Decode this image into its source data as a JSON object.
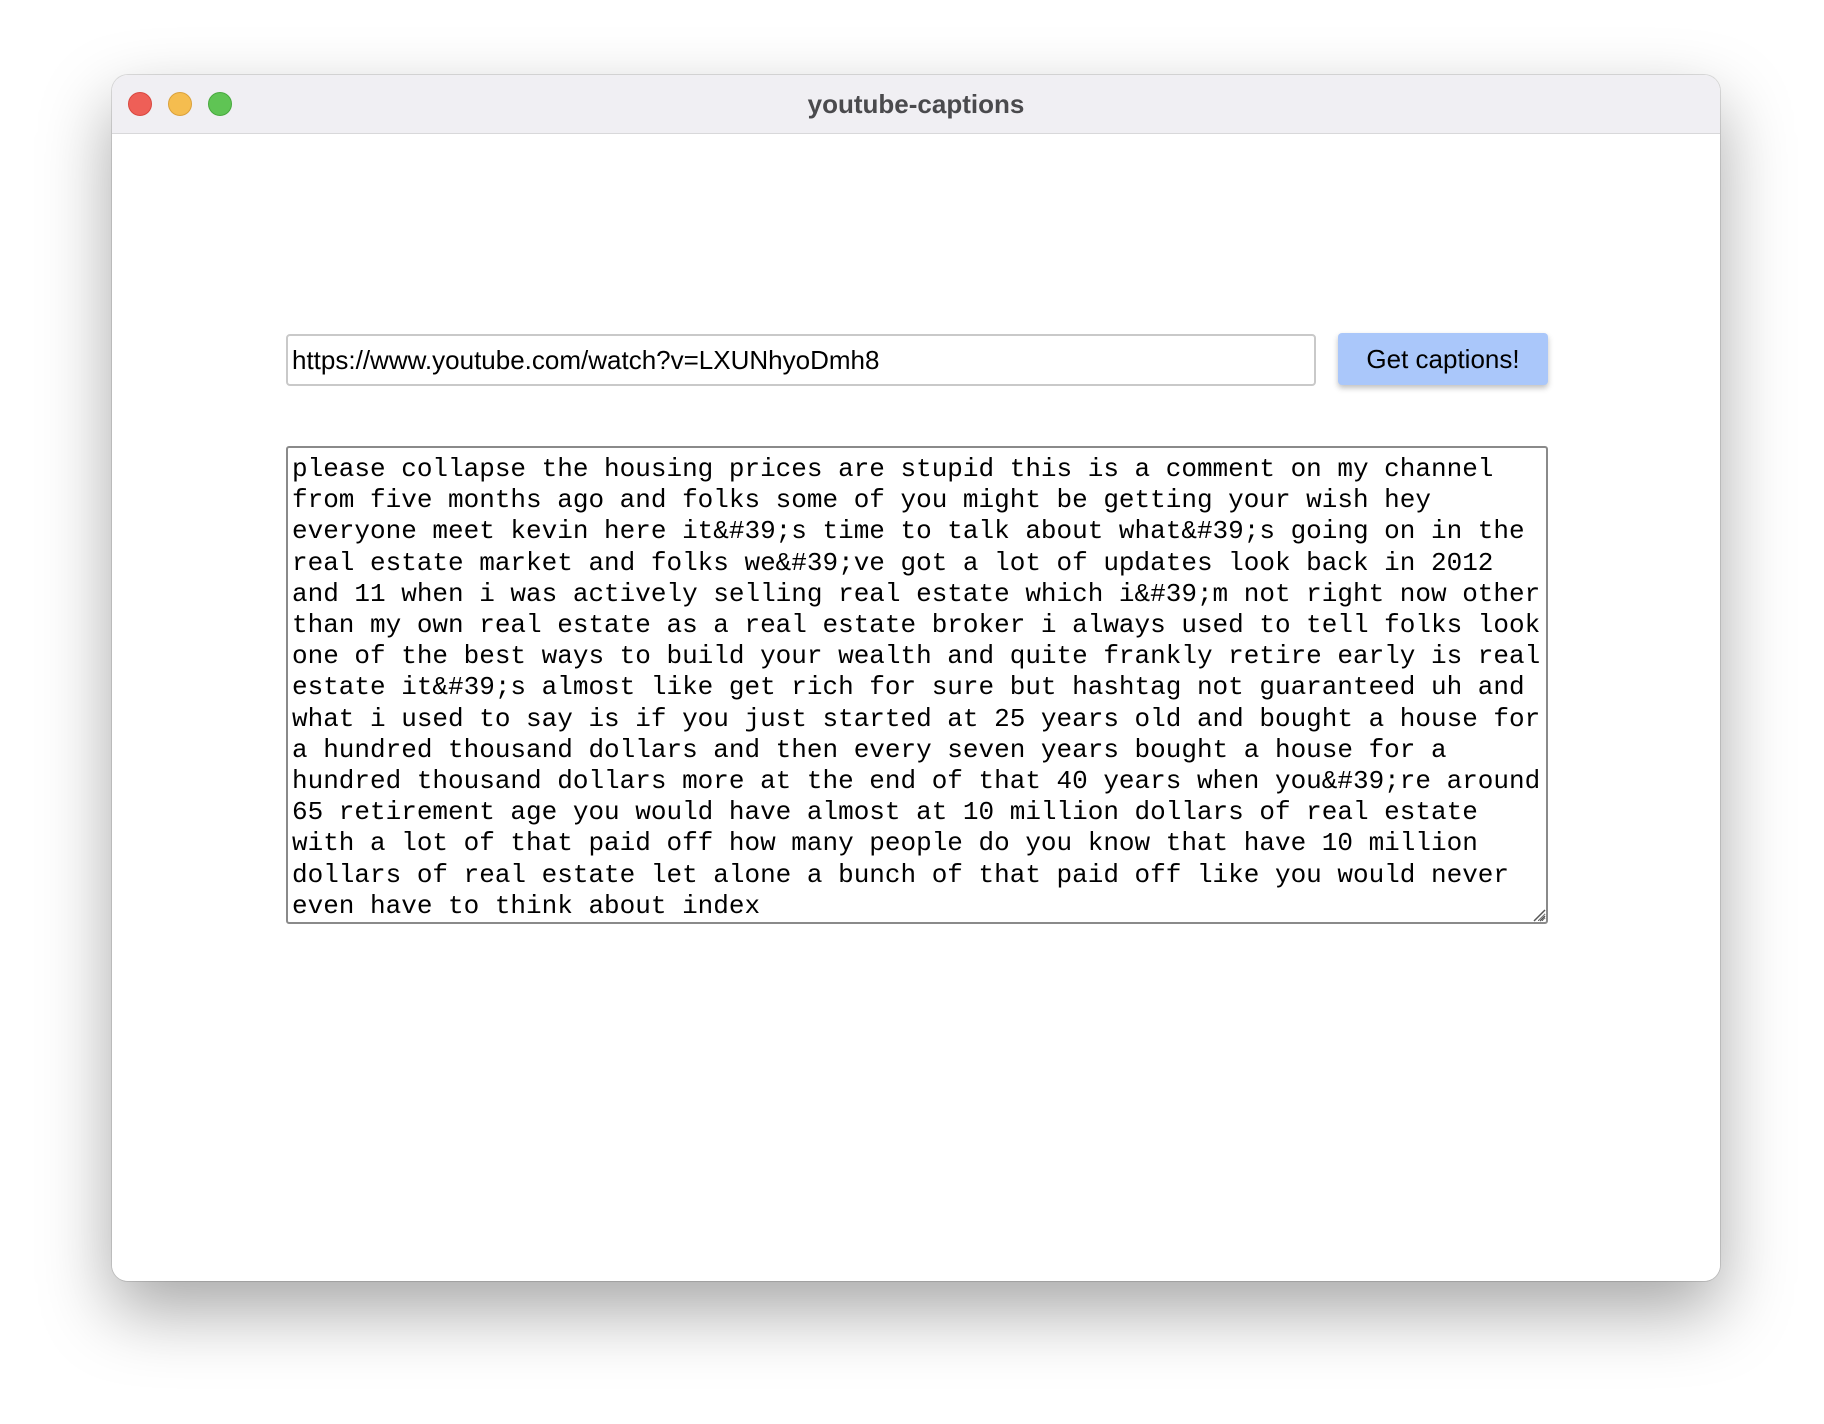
{
  "window": {
    "title": "youtube-captions"
  },
  "form": {
    "url_value": "https://www.youtube.com/watch?v=LXUNhyoDmh8",
    "submit_label": "Get captions!"
  },
  "captions": {
    "text": "please collapse the housing prices are stupid this is a comment on my channel from five months ago and folks some of you might be getting your wish hey everyone meet kevin here it&#39;s time to talk about what&#39;s going on in the real estate market and folks we&#39;ve got a lot of updates look back in 2012 and 11 when i was actively selling real estate which i&#39;m not right now other than my own real estate as a real estate broker i always used to tell folks look one of the best ways to build your wealth and quite frankly retire early is real estate it&#39;s almost like get rich for sure but hashtag not guaranteed uh and what i used to say is if you just started at 25 years old and bought a house for a hundred thousand dollars and then every seven years bought a house for a hundred thousand dollars more at the end of that 40 years when you&#39;re around 65 retirement age you would have almost at 10 million dollars of real estate with a lot of that paid off how many people do you know that have 10 million dollars of real estate let alone a bunch of that paid off like you would never even have to think about index"
  },
  "colors": {
    "button_bg": "#aac7fa",
    "titlebar_bg": "#f0eff3",
    "traffic_close": "#ee5f57",
    "traffic_minimize": "#f5bd4f",
    "traffic_zoom": "#5fc454"
  }
}
